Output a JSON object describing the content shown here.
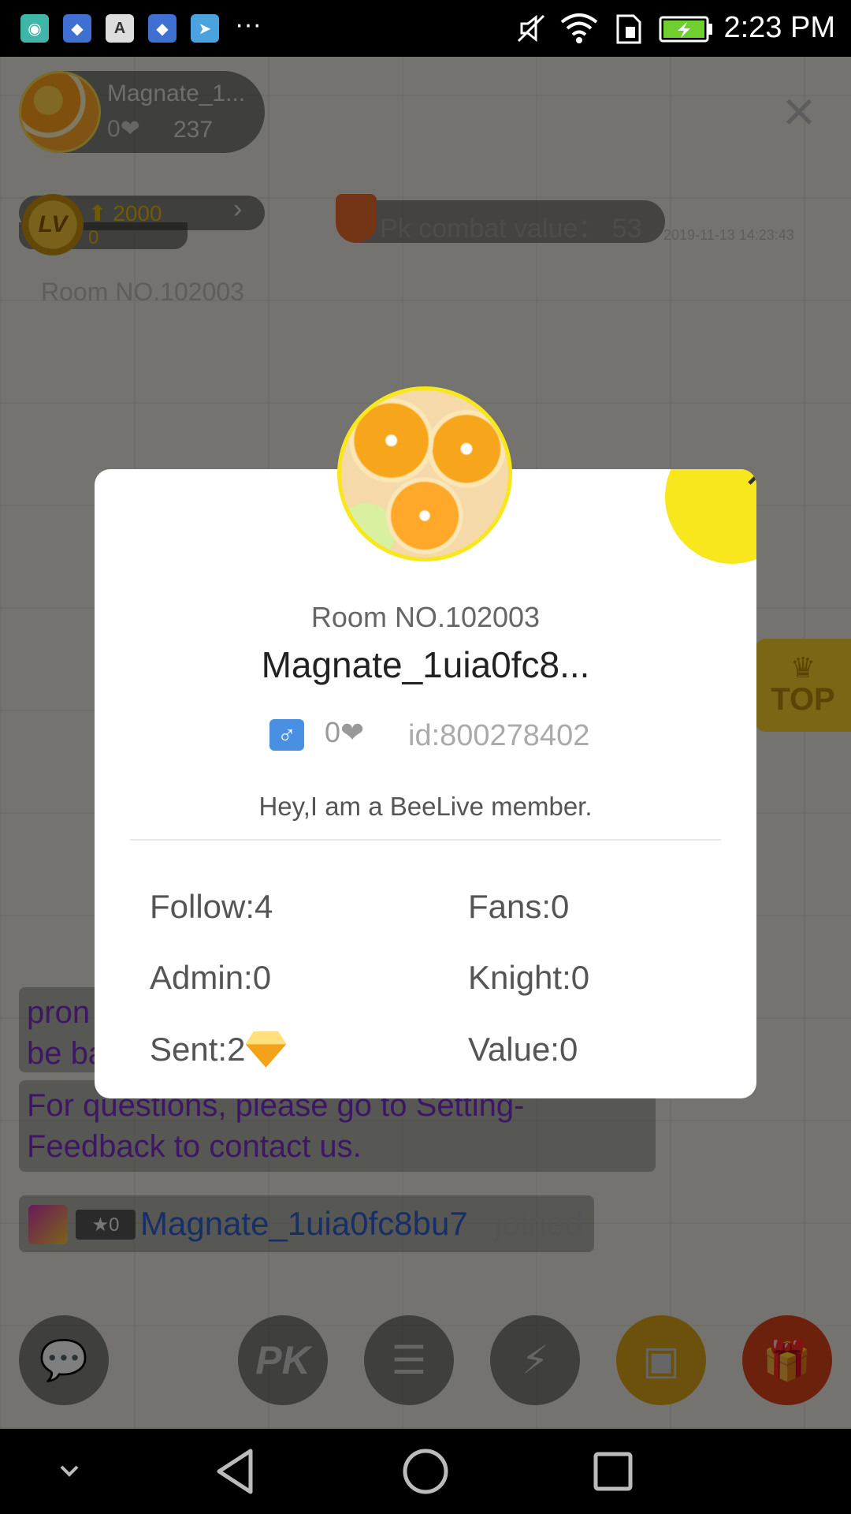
{
  "status_bar": {
    "time": "2:23 PM",
    "more": "···",
    "app_icons": [
      "android-icon",
      "baidu-icon",
      "font-icon",
      "baidu-icon",
      "telegram-icon"
    ],
    "right_icons": [
      "mute-icon",
      "wifi-icon",
      "sim-icon",
      "battery-icon"
    ]
  },
  "live_room": {
    "streamer_name": "Magnate_1...",
    "streamer_heart": "0❤",
    "streamer_count": "237",
    "level_value": "2000",
    "level_sub": "0",
    "level_badge": "LV",
    "pk_text": "Pk combat value：  53",
    "pk_date": "2019-11-13 14:23:43",
    "room_no": "Room NO.102003",
    "top_label": "TOP",
    "chat_partial": "pron\nbe ba",
    "chat_feedback": "For questions, please go to Setting-Feedback to contact us.",
    "join_badge": "★0",
    "join_name": "Magnate_1uia0fc8bu7",
    "join_text": "joined"
  },
  "dialog": {
    "room_no": "Room NO.102003",
    "name": "Magnate_1uia0fc8...",
    "gender_symbol": "♂",
    "heart": "0❤",
    "id": "id:800278402",
    "bio": "Hey,I am a BeeLive member.",
    "stats": {
      "follow": "Follow:4",
      "fans": "Fans:0",
      "admin": "Admin:0",
      "knight": "Knight:0",
      "sent": "Sent:2",
      "value": "Value:0"
    }
  },
  "colors": {
    "accent_yellow": "#f8e71c",
    "dialog_bg": "#ffffff",
    "chat_purple": "#7a2fc9",
    "join_blue": "#2f5fc9"
  }
}
